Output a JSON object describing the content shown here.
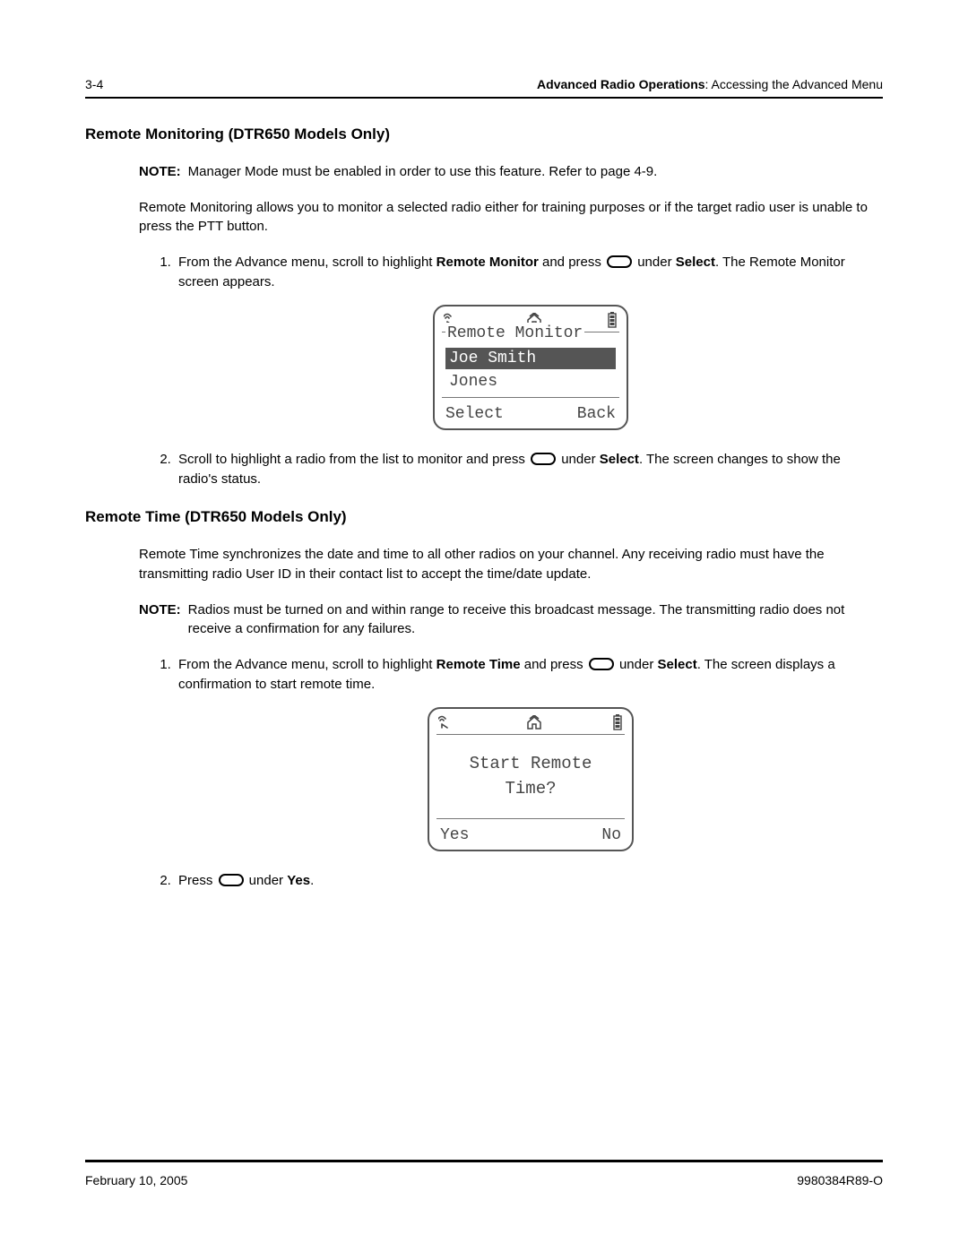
{
  "header": {
    "page_num": "3-4",
    "chapter_bold": "Advanced Radio Operations",
    "chapter_rest": ": Accessing the Advanced Menu"
  },
  "section1": {
    "title": "Remote Monitoring (DTR650 Models Only)",
    "note_label": "NOTE:",
    "note_text": "Manager Mode must be enabled in order to use this feature. Refer to page 4-9.",
    "body": "Remote Monitoring allows you to monitor a selected radio either for training purposes or if the target radio user is unable to press the PTT button.",
    "step1": {
      "pre": "From the Advance menu, scroll to highlight ",
      "bold1": "Remote Monitor",
      "mid": " and press ",
      "mid2": " under ",
      "bold2": "Select",
      "post": ". The Remote Monitor screen appears."
    },
    "step2": {
      "pre": "Scroll to highlight a radio from the list to monitor and press ",
      "mid": " under ",
      "bold": "Select",
      "post": ". The screen changes to show the radio's status."
    }
  },
  "screen1": {
    "title": "Remote Monitor",
    "selected": "Joe Smith",
    "other": "Jones",
    "soft_left": "Select",
    "soft_right": "Back"
  },
  "section2": {
    "title": "Remote Time (DTR650 Models Only)",
    "body": "Remote Time synchronizes the date and time to all other radios on your channel. Any receiving radio must have the transmitting radio User ID in their contact list to accept the time/date update.",
    "note_label": "NOTE:",
    "note_text": "Radios must be turned on and within range to receive this broadcast message. The transmitting radio does not receive a confirmation for any failures.",
    "step1": {
      "pre": "From the Advance menu, scroll to highlight ",
      "bold1": "Remote Time",
      "mid": " and press ",
      "mid2": " under ",
      "bold2": "Select",
      "post": ". The screen displays a confirmation to start remote time."
    },
    "step2": {
      "pre": "Press ",
      "mid": " under ",
      "bold": "Yes",
      "post": "."
    }
  },
  "screen2": {
    "line1": "Start Remote",
    "line2": "Time?",
    "soft_left": "Yes",
    "soft_right": "No"
  },
  "footer": {
    "date": "February 10, 2005",
    "docnum": "9980384R89-O"
  }
}
